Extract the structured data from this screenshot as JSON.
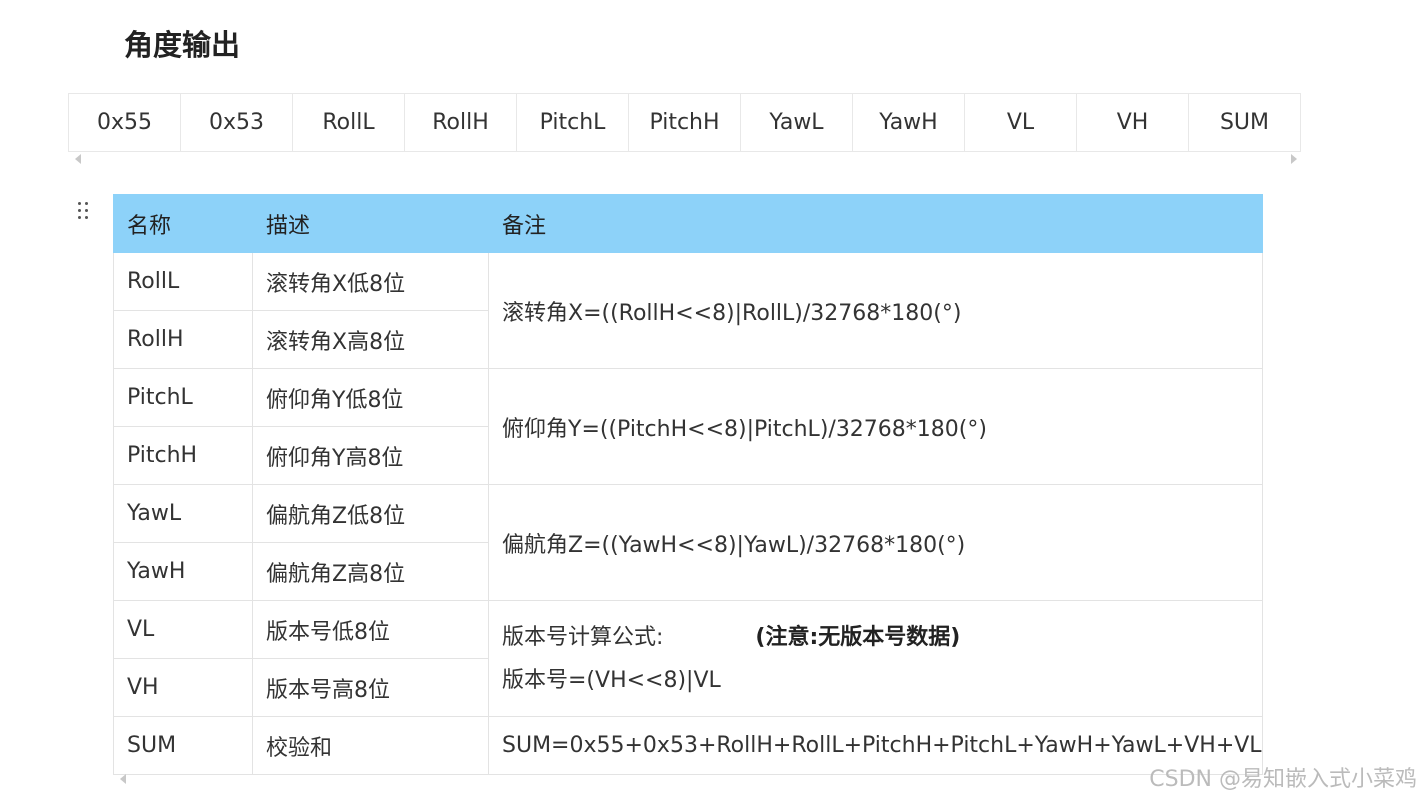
{
  "heading": "角度输出",
  "frame_bytes": [
    "0x55",
    "0x53",
    "RollL",
    "RollH",
    "PitchL",
    "PitchH",
    "YawL",
    "YawH",
    "VL",
    "VH",
    "SUM"
  ],
  "table": {
    "headers": [
      "名称",
      "描述",
      "备注"
    ],
    "rows": [
      {
        "name": "RollL",
        "desc": "滚转角X低8位"
      },
      {
        "name": "RollH",
        "desc": "滚转角X高8位"
      },
      {
        "name": "PitchL",
        "desc": "俯仰角Y低8位"
      },
      {
        "name": "PitchH",
        "desc": "俯仰角Y高8位"
      },
      {
        "name": "YawL",
        "desc": "偏航角Z低8位"
      },
      {
        "name": "YawH",
        "desc": "偏航角Z高8位"
      },
      {
        "name": "VL",
        "desc": "版本号低8位"
      },
      {
        "name": "VH",
        "desc": "版本号高8位"
      },
      {
        "name": "SUM",
        "desc": "校验和"
      }
    ],
    "remarks": {
      "roll": "滚转角X=((RollH<<8)|RollL)/32768*180(°)",
      "pitch": "俯仰角Y=((PitchH<<8)|PitchL)/32768*180(°)",
      "yaw": "偏航角Z=((YawH<<8)|YawL)/32768*180(°)",
      "version_label": "版本号计算公式:",
      "version_note": "(注意:无版本号数据)",
      "version_formula": "版本号=(VH<<8)|VL",
      "sum": "SUM=0x55+0x53+RollH+RollL+PitchH+PitchL+YawH+YawL+VH+VL"
    }
  },
  "watermark": "CSDN @易知嵌入式小菜鸡",
  "colors": {
    "header_bg": "#8dd2f9",
    "border": "#e3e3e3"
  },
  "icons": {
    "drag_handle": "drag-handle-icon",
    "scroll_left": "scroll-left-arrow-icon",
    "scroll_right": "scroll-right-arrow-icon"
  }
}
